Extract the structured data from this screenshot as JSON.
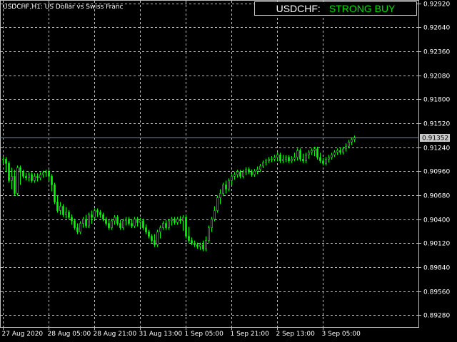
{
  "header": {
    "symbol": "USDCHF",
    "timeframe": "H1",
    "description": "US Dollar vs Swiss Franc"
  },
  "signal": {
    "symbol_label": "USDCHF:",
    "value": "STRONG BUY",
    "color": "#00dd00"
  },
  "current_price": {
    "label": "0.91352",
    "value": 0.91352
  },
  "colors": {
    "background": "#000000",
    "grid": "#c0c0c0",
    "candle": "#00ff00",
    "text": "#ffffff",
    "price_line": "#778899"
  },
  "chart_data": {
    "type": "candlestick",
    "y_axis": {
      "min": 0.8914,
      "max": 0.9295,
      "ticks": [
        "0.92920",
        "0.92640",
        "0.92360",
        "0.92080",
        "0.91800",
        "0.91520",
        "0.91240",
        "0.90960",
        "0.90680",
        "0.90400",
        "0.90120",
        "0.89840",
        "0.89560",
        "0.89280"
      ]
    },
    "x_axis": {
      "ticks": [
        "27 Aug 2020",
        "28 Aug 05:00",
        "28 Aug 21:00",
        "31 Aug 13:00",
        "1 Sep 05:00",
        "1 Sep 21:00",
        "2 Sep 13:00",
        "3 Sep 05:00"
      ],
      "candles_per_tick": 16
    },
    "grid": true,
    "close": [
      0.911,
      0.9105,
      0.9085,
      0.909,
      0.907,
      0.91,
      0.9095,
      0.909,
      0.9088,
      0.9092,
      0.9085,
      0.909,
      0.9088,
      0.9092,
      0.9094,
      0.9095,
      0.909,
      0.908,
      0.906,
      0.905,
      0.9055,
      0.9045,
      0.9048,
      0.9042,
      0.9038,
      0.903,
      0.9025,
      0.9035,
      0.904,
      0.9032,
      0.9045,
      0.9042,
      0.905,
      0.9048,
      0.9045,
      0.904,
      0.9035,
      0.903,
      0.9038,
      0.9042,
      0.9035,
      0.903,
      0.9038,
      0.904,
      0.9035,
      0.9032,
      0.904,
      0.9036,
      0.9038,
      0.903,
      0.9025,
      0.902,
      0.9015,
      0.901,
      0.9025,
      0.903,
      0.9035,
      0.903,
      0.9038,
      0.904,
      0.9036,
      0.904,
      0.9038,
      0.9042,
      0.902,
      0.9015,
      0.9012,
      0.901,
      0.9008,
      0.901,
      0.9005,
      0.9015,
      0.903,
      0.904,
      0.905,
      0.9065,
      0.907,
      0.908,
      0.9075,
      0.9085,
      0.909,
      0.9092,
      0.9095,
      0.909,
      0.9095,
      0.9098,
      0.9095,
      0.9092,
      0.9096,
      0.9098,
      0.9102,
      0.9106,
      0.9108,
      0.911,
      0.911,
      0.9112,
      0.9115,
      0.9108,
      0.911,
      0.9112,
      0.9108,
      0.911,
      0.9112,
      0.912,
      0.911,
      0.9108,
      0.9115,
      0.9118,
      0.912,
      0.9122,
      0.9112,
      0.9108,
      0.9105,
      0.911,
      0.9112,
      0.9115,
      0.9118,
      0.912,
      0.9118,
      0.9122,
      0.9125,
      0.913,
      0.9133,
      0.9135
    ]
  }
}
